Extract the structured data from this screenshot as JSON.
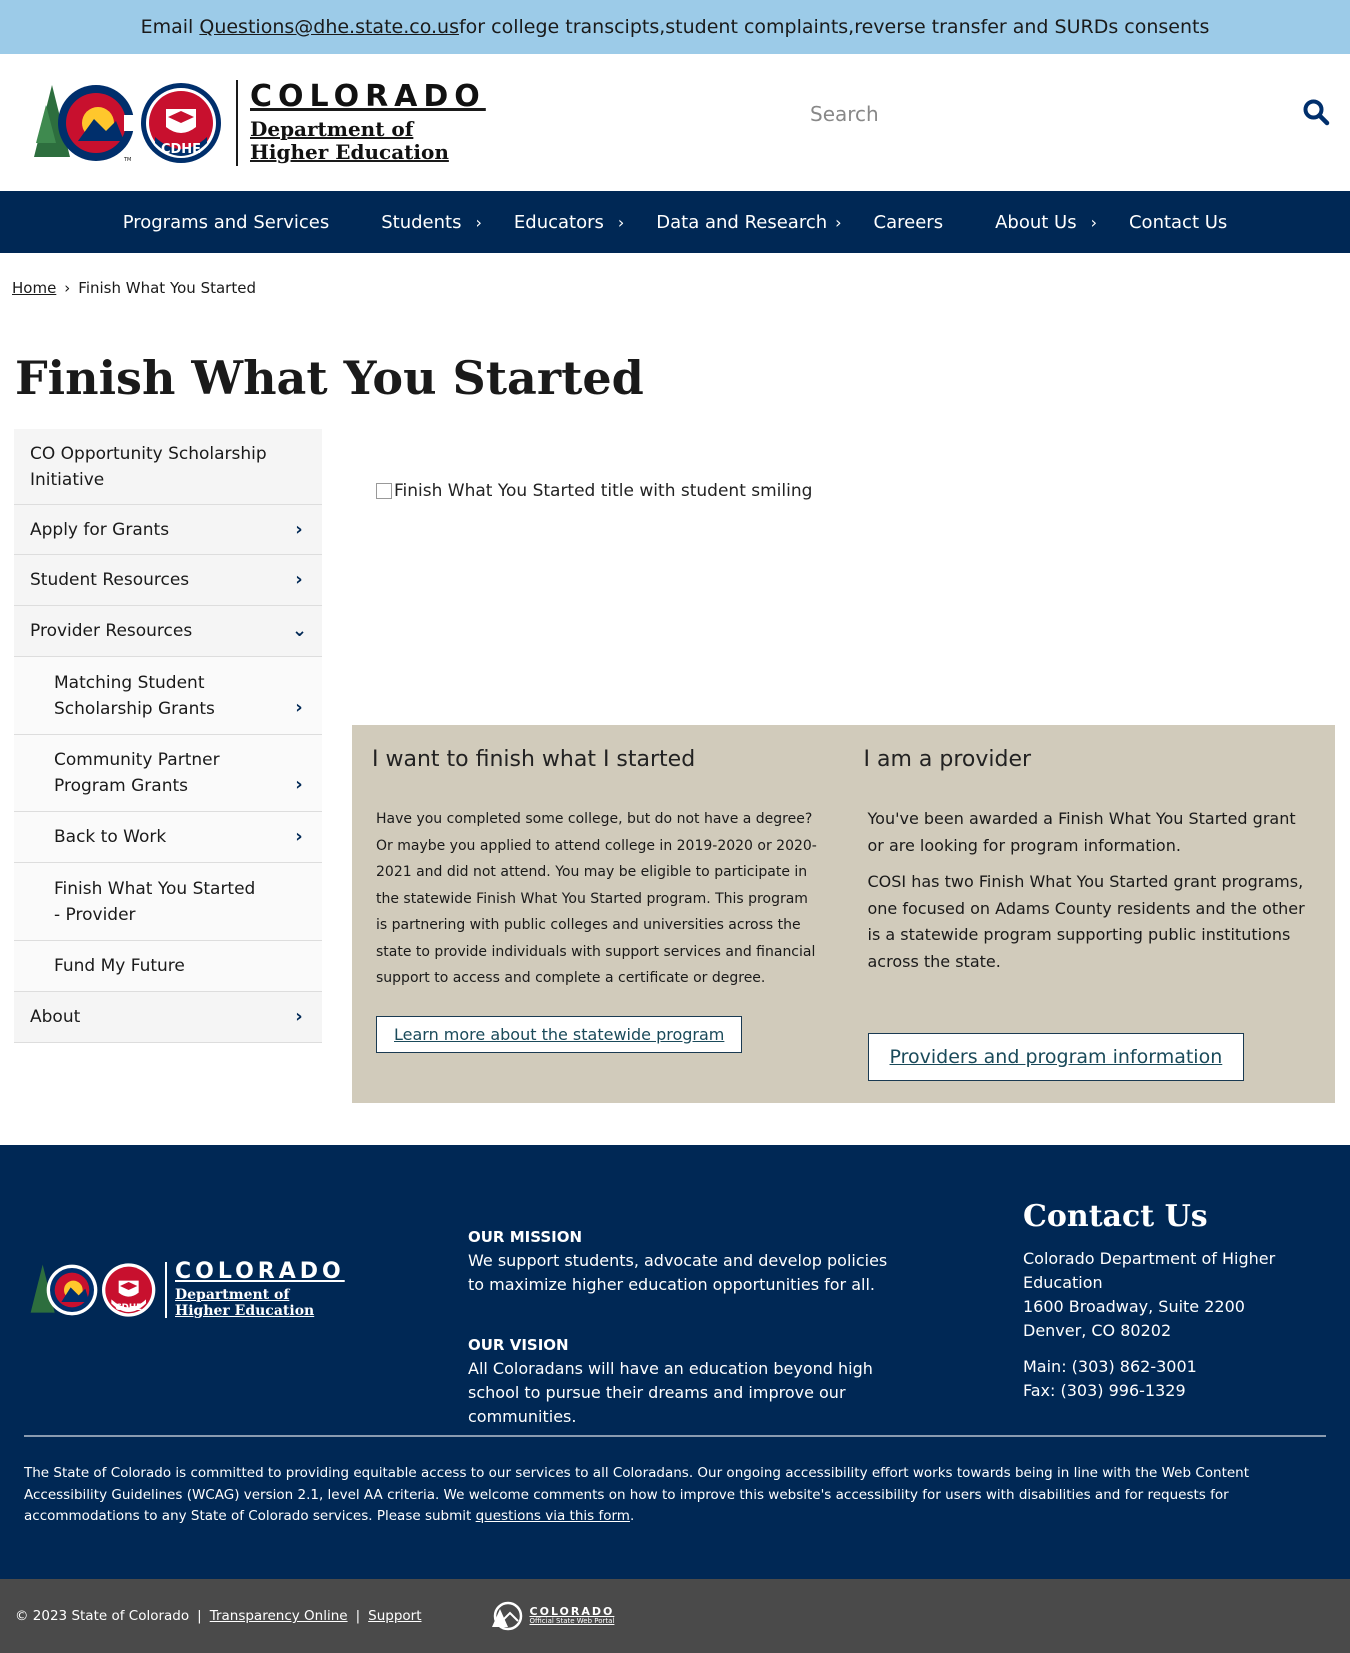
{
  "alert": {
    "prefix": "Email ",
    "email": "Questions@dhe.state.co.us",
    "suffix": " for college transcipts,student complaints,reverse transfer and SURDs consents"
  },
  "logo": {
    "state": "COLORADO",
    "dept_line1": "Department of",
    "dept_line2": "Higher Education",
    "badge": "CDHE",
    "tm": "TM"
  },
  "search": {
    "placeholder": "Search",
    "icon": "search-icon"
  },
  "nav": {
    "items": [
      {
        "label": "Programs and Services",
        "caret": false
      },
      {
        "label": "Students",
        "caret": true
      },
      {
        "label": "Educators",
        "caret": true
      },
      {
        "label": "Data and Research",
        "caret": true
      },
      {
        "label": "Careers",
        "caret": false
      },
      {
        "label": "About Us",
        "caret": true
      },
      {
        "label": "Contact Us",
        "caret": false
      }
    ],
    "caret_glyph": "›"
  },
  "breadcrumb": {
    "home": "Home",
    "sep": "›",
    "current": "Finish What You Started"
  },
  "page_title": "Finish What You Started",
  "sidebar": {
    "items": [
      {
        "label": "CO Opportunity Scholarship Initiative",
        "chev": ""
      },
      {
        "label": "Apply for Grants",
        "chev": "›"
      },
      {
        "label": "Student Resources",
        "chev": "›"
      },
      {
        "label": "Provider Resources",
        "chev": "⌄"
      },
      {
        "label": "Matching Student Scholarship Grants",
        "chev": "›"
      },
      {
        "label": "Community Partner Program Grants",
        "chev": "›"
      },
      {
        "label": "Back to Work",
        "chev": "›"
      },
      {
        "label": "Finish What You Started - Provider",
        "chev": ""
      },
      {
        "label": "Fund My Future",
        "chev": ""
      },
      {
        "label": "About",
        "chev": "›"
      }
    ]
  },
  "hero": {
    "alt": "Finish What You Started title with student smiling"
  },
  "panel": {
    "left": {
      "heading": "I want to finish what I started",
      "body": "Have you completed some college, but do not have a degree?  Or maybe you  applied to attend college in 2019-2020 or 2020-2021 and did not attend.  You may be eligible to participate in the statewide Finish What You Started program.  This program is partnering with public colleges and universities across the state to provide individuals with support services and financial support to access and complete a certificate or degree.",
      "button": "Learn more about the statewide program"
    },
    "right": {
      "heading": "I am a provider",
      "body1": "You've been awarded a Finish What You Started grant or are looking for program information.",
      "body2": "COSI has two Finish What You Started grant programs, one focused on Adams County residents and the other is a statewide program supporting public institutions across the state.",
      "button": "Providers and program information"
    }
  },
  "footer": {
    "mission_head": "OUR MISSION",
    "mission": "We support students, advocate and develop policies to maximize higher education opportunities for all.",
    "vision_head": "OUR VISION",
    "vision": "All Coloradans will have an education beyond high school to pursue their dreams and improve our communities.",
    "contact_title": "Contact Us",
    "org": "Colorado Department of Higher Education",
    "addr1": "1600 Broadway, Suite 2200",
    "addr2": "Denver, CO 80202",
    "main": "Main: (303) 862-3001",
    "fax": "Fax: (303) 996-1329",
    "access": "The State of Colorado is committed to providing equitable access to our services to all Coloradans. Our ongoing accessibility effort works towards being in line with the Web Content Accessibility Guidelines (WCAG) version 2.1, level AA criteria. We welcome comments on how to improve this website's accessibility for users with disabilities and for requests for accommodations to any State of Colorado services. Please submit ",
    "access_link": "questions via this form",
    "access_end": "."
  },
  "bottom": {
    "copyright": "© 2023 State of Colorado",
    "sep": "|",
    "transparency": "Transparency Online",
    "support": "Support",
    "portal_line1": "COLORADO",
    "portal_line2": "Official State Web Portal"
  },
  "colors": {
    "alert_bg": "#9ccbe8",
    "nav_bg": "#002855",
    "panel_bg": "#d1cbbb",
    "footer_bg": "#002855",
    "bottom_bg": "#4a4a4a"
  }
}
